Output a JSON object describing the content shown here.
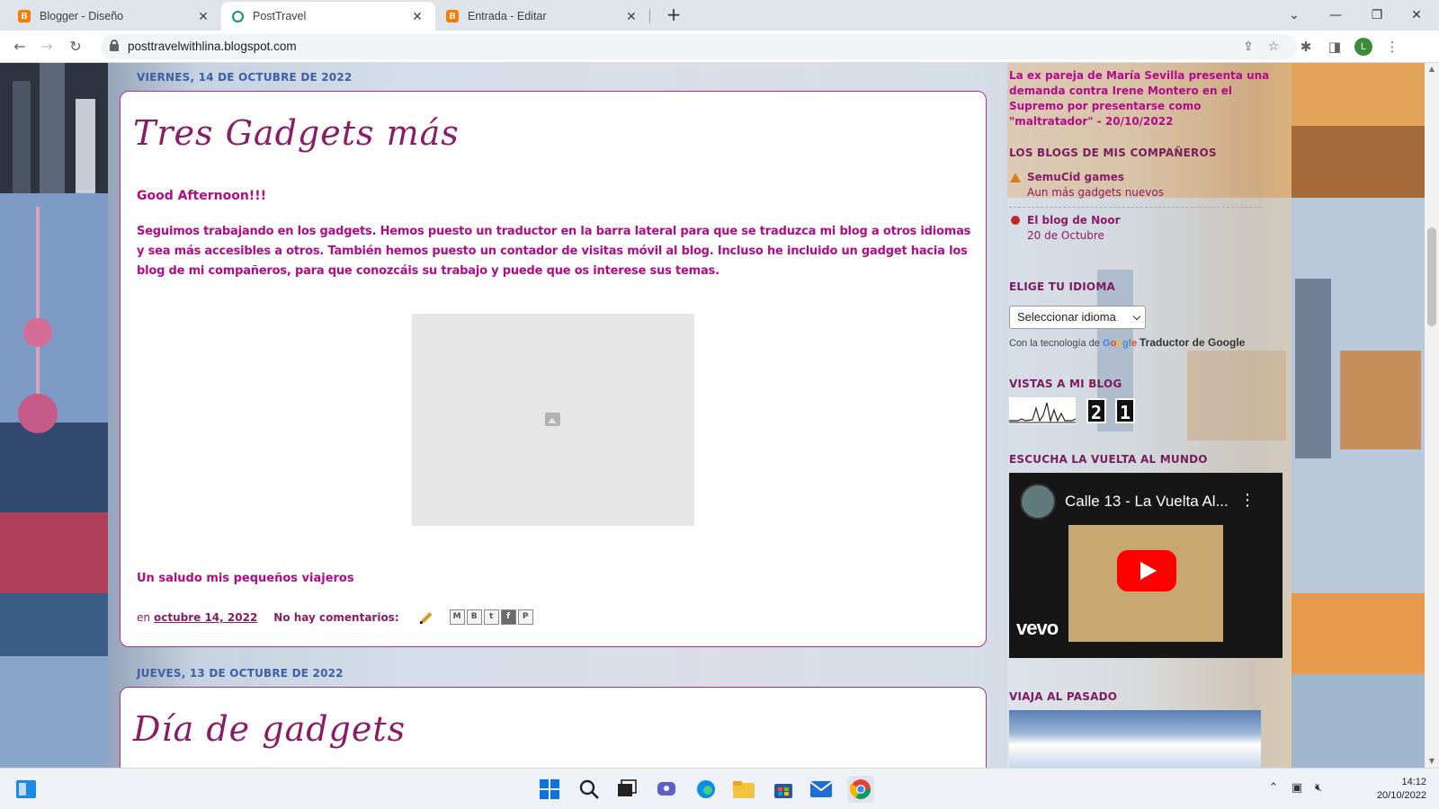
{
  "browser": {
    "tabs": [
      {
        "label": "Blogger - Diseño",
        "icon": "blogger-icon"
      },
      {
        "label": "PostTravel",
        "icon": "posttravel-icon",
        "active": true
      },
      {
        "label": "Entrada - Editar",
        "icon": "blogger-icon"
      }
    ],
    "url": "posttravelwithlina.blogspot.com",
    "profile_initial": "L"
  },
  "blog": {
    "post1": {
      "date_header": "VIERNES, 14 DE OCTUBRE DE 2022",
      "title": "Tres Gadgets más",
      "greeting": "Good Afternoon!!!",
      "body": " Seguimos trabajando en los gadgets. Hemos puesto un traductor en la barra lateral para que se traduzca mi blog a otros idiomas y sea más accesibles a otros. También hemos puesto un contador de visitas móvil al blog. Incluso he incluido un gadget hacia los blog de mi compañeros, para que conozcáis su trabajo y puede que os interese sus temas.",
      "signoff": "Un saludo mis pequeños viajeros",
      "meta_prefix": "en",
      "meta_date": "octubre 14, 2022",
      "meta_comments": "No hay comentarios:",
      "share_buttons": [
        "email-share",
        "blog-this",
        "twitter-share",
        "facebook-share",
        "pinterest-share"
      ]
    },
    "post2": {
      "date_header": "JUEVES, 13 DE OCTUBRE DE 2022",
      "title": "Día de gadgets"
    }
  },
  "sidebar": {
    "news_text": "La ex pareja de María Sevilla presenta una demanda contra Irene Montero en el Supremo por presentarse como \"maltratador\" - 20/10/2022",
    "blogs_header": "LOS BLOGS DE MIS COMPAÑEROS",
    "blogs": [
      {
        "name": "SemuCid games",
        "sub": "Aun más gadgets nuevos"
      },
      {
        "name": "El blog de Noor",
        "sub": "20 de Octubre"
      }
    ],
    "lang_header": "ELIGE TU IDIOMA",
    "lang_select": "Seleccionar idioma",
    "lang_powered_prefix": "Con la tecnología de",
    "lang_powered_logo": "Google",
    "lang_powered_suffix": "Traductor de Google",
    "views_header": "VISTAS A MI BLOG",
    "views_digits": [
      "2",
      "1"
    ],
    "music_header": "ESCUCHA LA VUELTA AL MUNDO",
    "video_title": "Calle 13 - La Vuelta Al...",
    "video_brand": "vevo",
    "past_header": "VIAJA AL PASADO"
  },
  "taskbar": {
    "time": "14:12",
    "date": "20/10/2022"
  }
}
